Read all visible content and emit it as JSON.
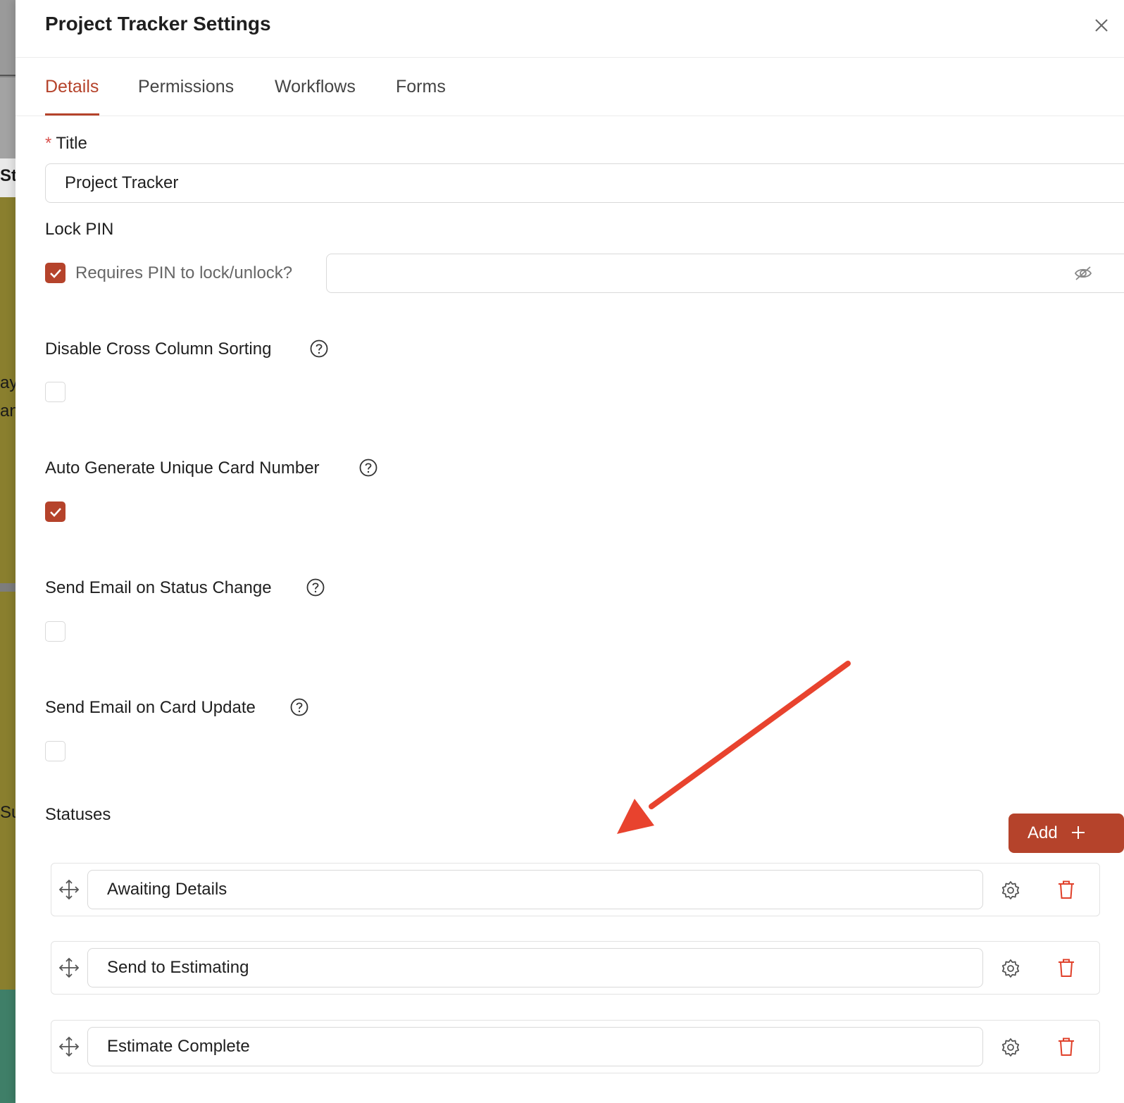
{
  "background": {
    "fragments": [
      "Sta",
      "ay,",
      "an",
      "Su"
    ]
  },
  "panel": {
    "title": "Project Tracker Settings",
    "close_icon": "close-icon"
  },
  "tabs": [
    {
      "label": "Details",
      "active": true
    },
    {
      "label": "Permissions",
      "active": false
    },
    {
      "label": "Workflows",
      "active": false
    },
    {
      "label": "Forms",
      "active": false
    }
  ],
  "form": {
    "title_required_mark": "*",
    "title_label": "Title",
    "title_value": "Project Tracker",
    "lock_pin_label": "Lock PIN",
    "requires_pin_checked": true,
    "requires_pin_label": "Requires PIN to lock/unlock?",
    "pin_value": "",
    "pin_visibility_icon": "eye-slash-icon",
    "disable_cross_column_sorting_label": "Disable Cross Column Sorting",
    "disable_cross_column_sorting_checked": false,
    "auto_generate_card_number_label": "Auto Generate Unique Card Number",
    "auto_generate_card_number_checked": true,
    "send_email_status_change_label": "Send Email on Status Change",
    "send_email_status_change_checked": false,
    "send_email_card_update_label": "Send Email on Card Update",
    "send_email_card_update_checked": false,
    "help_icon": "question-circle-icon"
  },
  "statuses": {
    "label": "Statuses",
    "add_button_label": "Add",
    "items": [
      {
        "name": "Awaiting Details"
      },
      {
        "name": "Send to Estimating"
      },
      {
        "name": "Estimate Complete"
      }
    ]
  },
  "colors": {
    "accent": "#b5432b",
    "annotation_arrow": "#e8432e",
    "delete_icon": "#e0402a"
  }
}
